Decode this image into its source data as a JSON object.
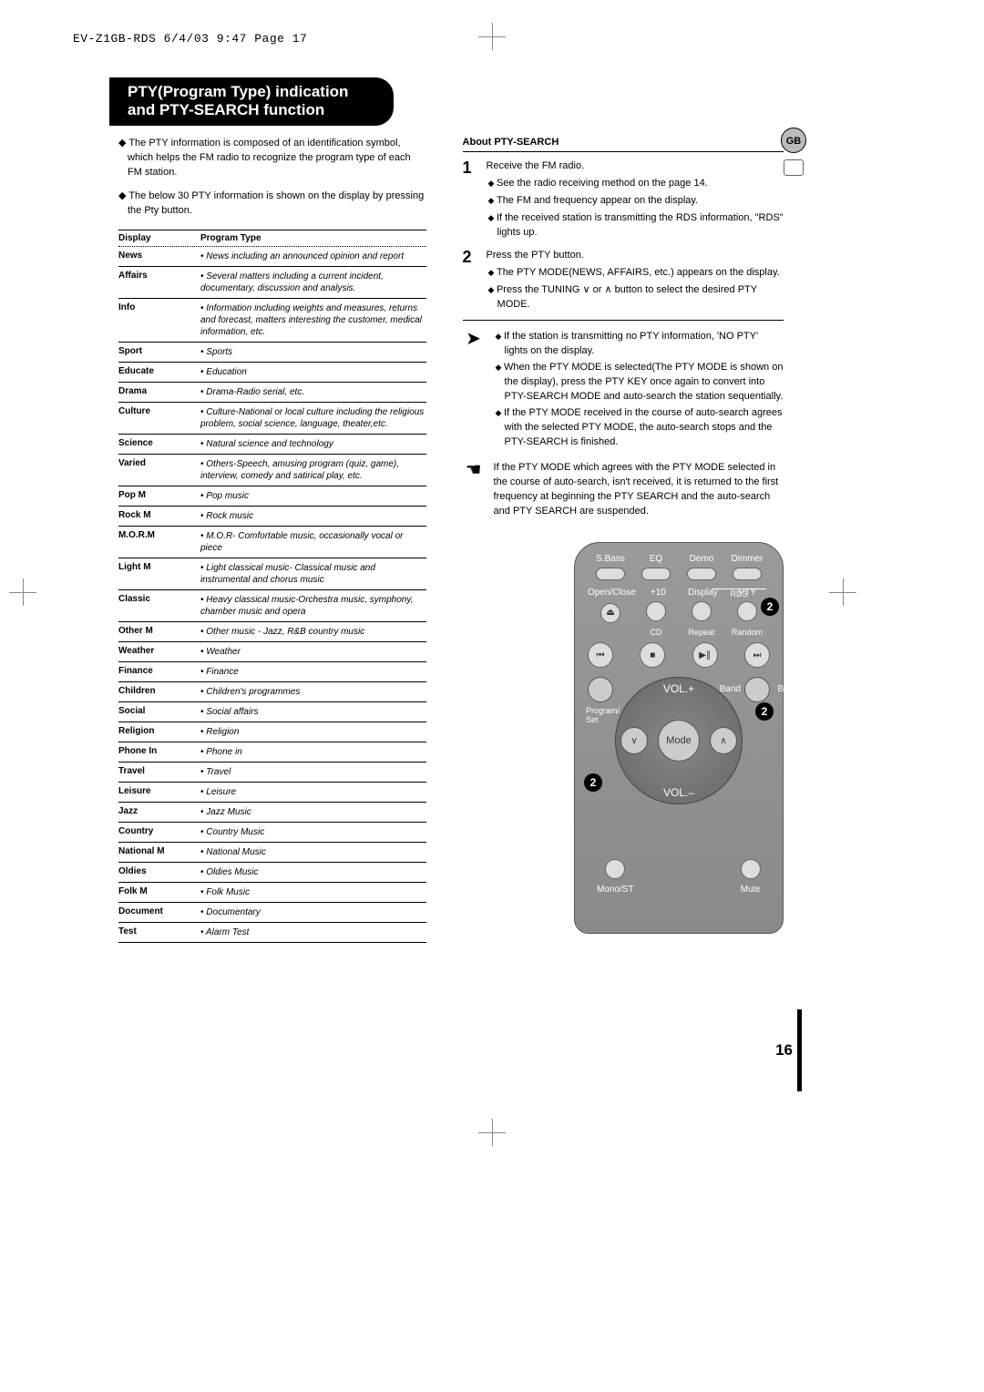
{
  "header_stamp": "EV-Z1GB-RDS  6/4/03 9:47  Page 17",
  "title_line1": "PTY(Program Type) indication",
  "title_line2": "and PTY-SEARCH function",
  "side_tab": "GB",
  "intro": [
    "The PTY information is composed of an identification symbol, which helps the FM radio to recognize the program type of each FM station.",
    "The below 30 PTY information is shown on the display by pressing the Pty button."
  ],
  "table_headers": {
    "c1": "Display",
    "c2": "Program Type"
  },
  "pty_rows": [
    {
      "c1": "News",
      "c2": "News including an announced opinion and report"
    },
    {
      "c1": "Affairs",
      "c2": "Several matters including a current incident, documentary, discussion and analysis."
    },
    {
      "c1": "Info",
      "c2": "Information including weights and measures, returns and forecast, matters interesting the customer, medical information, etc."
    },
    {
      "c1": "Sport",
      "c2": "Sports"
    },
    {
      "c1": "Educate",
      "c2": "Education"
    },
    {
      "c1": "Drama",
      "c2": "Drama-Radio serial, etc."
    },
    {
      "c1": "Culture",
      "c2": "Culture-National or local culture including the religious problem, social science, language, theater,etc."
    },
    {
      "c1": "Science",
      "c2": "Natural science and technology"
    },
    {
      "c1": "Varied",
      "c2": "Others-Speech, amusing program (quiz, game), interview, comedy and satirical play, etc."
    },
    {
      "c1": "Pop M",
      "c2": "Pop music"
    },
    {
      "c1": "Rock M",
      "c2": "Rock music"
    },
    {
      "c1": "M.O.R.M",
      "c2": "M.O.R- Comfortable music, occasionally vocal or piece"
    },
    {
      "c1": "Light M",
      "c2": "Light classical music- Classical music and instrumental and chorus music"
    },
    {
      "c1": "Classic",
      "c2": "Heavy classical  music-Orchestra music, symphony, chamber music and opera"
    },
    {
      "c1": "Other M",
      "c2": "Other music - Jazz, R&B country music"
    },
    {
      "c1": "Weather",
      "c2": "Weather"
    },
    {
      "c1": "Finance",
      "c2": "Finance"
    },
    {
      "c1": "Children",
      "c2": "Children's programmes"
    },
    {
      "c1": "Social",
      "c2": "Social affairs"
    },
    {
      "c1": "Religion",
      "c2": "Religion"
    },
    {
      "c1": "Phone In",
      "c2": "Phone in"
    },
    {
      "c1": "Travel",
      "c2": "Travel"
    },
    {
      "c1": "Leisure",
      "c2": "Leisure"
    },
    {
      "c1": "Jazz",
      "c2": "Jazz Music"
    },
    {
      "c1": "Country",
      "c2": "Country Music"
    },
    {
      "c1": "National M",
      "c2": "National Music"
    },
    {
      "c1": "Oldies",
      "c2": "Oldies Music"
    },
    {
      "c1": "Folk M",
      "c2": "Folk Music"
    },
    {
      "c1": "Document",
      "c2": "Documentary"
    },
    {
      "c1": "Test",
      "c2": "Alarm Test"
    }
  ],
  "about_heading": "About PTY-SEARCH",
  "steps": [
    {
      "num": "1",
      "body": "Receive the FM radio.",
      "subs": [
        "See the radio receiving method on the page 14.",
        "The FM and frequency appear on the display.",
        "If the received station is transmitting the RDS information, \"RDS\" lights up."
      ]
    },
    {
      "num": "2",
      "body": "Press the PTY button.",
      "subs": [
        "The PTY MODE(NEWS, AFFAIRS, etc.) appears on the display.",
        "Press the TUNING  ∨  or  ∧  button to select the desired PTY MODE."
      ]
    }
  ],
  "note_arrow_subs": [
    "If the station is transmitting no PTY information, 'NO PTY' lights on the display.",
    "When the PTY MODE is selected(The PTY MODE is shown on the display), press the PTY KEY once again to convert into PTY-SEARCH MODE and auto-search the station sequentially.",
    "If the PTY MODE received in the course of auto-search agrees with the selected PTY MODE, the auto-search stops and the PTY-SEARCH is finished."
  ],
  "note_hand": "If the PTY MODE which agrees with the PTY MODE selected in the course of auto-search, isn't received, it is returned to the first frequency at beginning the PTY SEARCH and the auto-search and PTY SEARCH are suspended.",
  "remote": {
    "row1": [
      "S.Bass",
      "EQ",
      "Demo",
      "Dimmer"
    ],
    "row2": [
      "Open/Close",
      "+10",
      "Display",
      "PTY"
    ],
    "rds": "RDS",
    "repeat": "Repeat",
    "random": "Random",
    "cd": "CD",
    "program": "Program/\nSet",
    "band": "Band",
    "volup": "VOL.+",
    "voldown": "VOL.–",
    "mode": "Mode",
    "mono": "Mono/ST",
    "mute": "Mute",
    "badge": "2"
  },
  "page_number": "16"
}
